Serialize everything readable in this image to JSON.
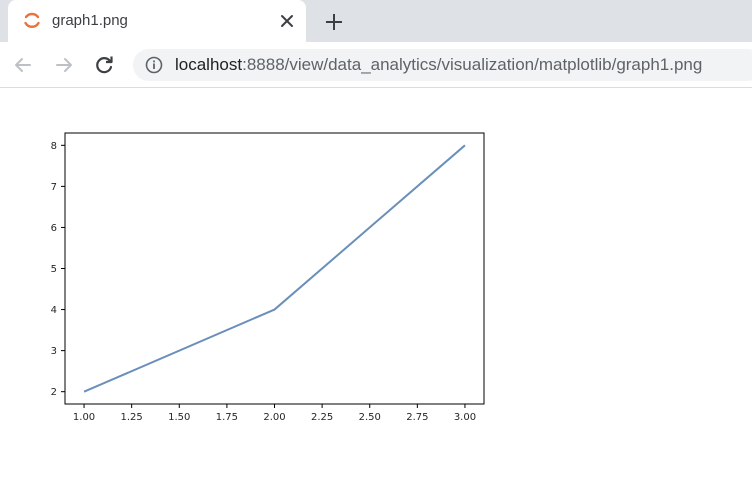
{
  "browser": {
    "tab": {
      "title": "graph1.png",
      "icon": "loading-spinner-icon"
    },
    "address": {
      "host": "localhost",
      "rest": ":8888/view/data_analytics/visualization/matplotlib/graph1.png"
    }
  },
  "colors": {
    "line": "#6a8fba",
    "axes": "#000000",
    "tab_bg": "#dee1e6",
    "spinner": "#e8743b"
  },
  "chart_data": {
    "type": "line",
    "x": [
      1,
      2,
      3
    ],
    "series": [
      {
        "values": [
          2,
          4,
          8
        ]
      }
    ],
    "xlim": [
      0.9,
      3.1
    ],
    "ylim": [
      1.7,
      8.3
    ],
    "xticks": [
      1.0,
      1.25,
      1.5,
      1.75,
      2.0,
      2.25,
      2.5,
      2.75,
      3.0
    ],
    "xtick_labels": [
      "1.00",
      "1.25",
      "1.50",
      "1.75",
      "2.00",
      "2.25",
      "2.50",
      "2.75",
      "3.00"
    ],
    "yticks": [
      2,
      3,
      4,
      5,
      6,
      7,
      8
    ],
    "ytick_labels": [
      "2",
      "3",
      "4",
      "5",
      "6",
      "7",
      "8"
    ],
    "grid": false
  }
}
